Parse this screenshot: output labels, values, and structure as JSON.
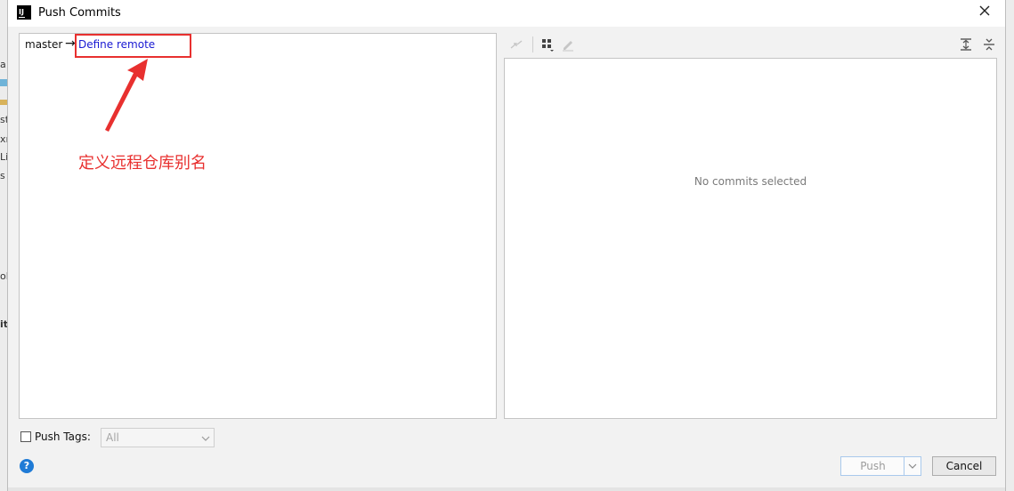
{
  "window": {
    "title": "Push Commits",
    "logo_text": "IJ"
  },
  "background_fragments": [
    "a",
    "st",
    "xı",
    "Li",
    "s",
    "ol",
    "it"
  ],
  "left_pane": {
    "branch": "master",
    "arrow": "→",
    "remote_link": "Define remote",
    "annotation": "定义远程仓库别名"
  },
  "toolbar": {
    "icons": [
      "cherry-pick-icon",
      "group-icon",
      "edit-icon",
      "expand-all-icon",
      "collapse-all-icon"
    ]
  },
  "right_pane": {
    "empty_text": "No commits selected"
  },
  "footer": {
    "push_tags_label": "Push Tags:",
    "push_tags_checked": false,
    "tags_select": {
      "value": "All"
    },
    "help_label": "?",
    "push_label": "Push",
    "cancel_label": "Cancel"
  },
  "colors": {
    "link": "#1919d2",
    "annotation": "#e8302f",
    "help": "#1f7bd6"
  }
}
